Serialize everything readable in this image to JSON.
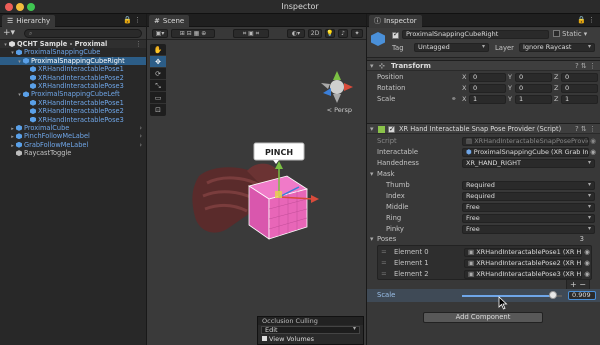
{
  "window": {
    "title": "Inspector"
  },
  "hierarchy": {
    "tab_label": "Hierarchy",
    "search_placeholder": "",
    "rows": [
      {
        "label": "QCHT Sample - Proximal",
        "depth": 0,
        "type": "scene",
        "expanded": true,
        "bold": true
      },
      {
        "label": "ProximalSnappingCube",
        "depth": 1,
        "type": "cube",
        "expanded": true
      },
      {
        "label": "ProximalSnappingCubeRight",
        "depth": 2,
        "type": "cube",
        "expanded": true,
        "selected": true
      },
      {
        "label": "XRHandInteractablePose1",
        "depth": 3,
        "type": "cube"
      },
      {
        "label": "XRHandInteractablePose2",
        "depth": 3,
        "type": "cube"
      },
      {
        "label": "XRHandInteractablePose3",
        "depth": 3,
        "type": "cube"
      },
      {
        "label": "ProximalSnappingCubeLeft",
        "depth": 2,
        "type": "cube",
        "expanded": true
      },
      {
        "label": "XRHandInteractablePose1",
        "depth": 3,
        "type": "cube"
      },
      {
        "label": "XRHandInteractablePose2",
        "depth": 3,
        "type": "cube"
      },
      {
        "label": "XRHandInteractablePose3",
        "depth": 3,
        "type": "cube"
      },
      {
        "label": "ProximalCube",
        "depth": 1,
        "type": "cube",
        "collapsed": true
      },
      {
        "label": "PinchFollowMeLabel",
        "depth": 1,
        "type": "cube",
        "collapsed": true
      },
      {
        "label": "GrabFollowMeLabel",
        "depth": 1,
        "type": "cube",
        "collapsed": true
      },
      {
        "label": "RaycastToggle",
        "depth": 1,
        "type": "gray"
      }
    ]
  },
  "scene": {
    "tab_label": "Scene",
    "toolbar_2d": "2D",
    "persp_label": "< Persp",
    "pinch_label": "PINCH",
    "tools": [
      "hand-tool",
      "move-tool",
      "rotate-tool",
      "scale-tool",
      "rect-tool",
      "transform-tool"
    ],
    "occlusion": {
      "title": "Occlusion Culling",
      "mode": "Edit",
      "view_volumes": "View Volumes"
    }
  },
  "inspector": {
    "tab_label": "Inspector",
    "object_name": "ProximalSnappingCubeRight",
    "static_label": "Static",
    "tag_label": "Tag",
    "tag_value": "Untagged",
    "layer_label": "Layer",
    "layer_value": "Ignore Raycast",
    "transform": {
      "title": "Transform",
      "position": {
        "label": "Position",
        "x": "0",
        "y": "0",
        "z": "0"
      },
      "rotation": {
        "label": "Rotation",
        "x": "0",
        "y": "0",
        "z": "0"
      },
      "scale": {
        "label": "Scale",
        "x": "1",
        "y": "1",
        "z": "1"
      }
    },
    "script_component": {
      "title": "XR Hand Interactable Snap Pose Provider (Script)",
      "script_label": "Script",
      "script_value": "XRHandInteractableSnapPoseProvider",
      "interactable_label": "Interactable",
      "interactable_value": "ProximalSnappingCube (XR Grab Inter",
      "handedness_label": "Handedness",
      "handedness_value": "XR_HAND_RIGHT",
      "mask_label": "Mask",
      "mask": [
        {
          "label": "Thumb",
          "value": "Required"
        },
        {
          "label": "Index",
          "value": "Required"
        },
        {
          "label": "Middle",
          "value": "Free"
        },
        {
          "label": "Ring",
          "value": "Free"
        },
        {
          "label": "Pinky",
          "value": "Free"
        }
      ],
      "poses_label": "Poses",
      "poses_count": "3",
      "poses": [
        {
          "label": "Element 0",
          "value": "XRHandInteractablePose1 (XR Hand"
        },
        {
          "label": "Element 1",
          "value": "XRHandInteractablePose2 (XR Hand"
        },
        {
          "label": "Element 2",
          "value": "XRHandInteractablePose3 (XR Hand"
        }
      ],
      "add_symbol": "+",
      "remove_symbol": "−",
      "scale_label": "Scale",
      "scale_value": "0.909",
      "scale_fraction": 0.909
    },
    "add_component_label": "Add Component"
  },
  "colors": {
    "accent": "#2c5d87",
    "cube_pink": "#e866b8",
    "hand": "#5a2b2b",
    "object_blue": "#6fa6e8"
  }
}
